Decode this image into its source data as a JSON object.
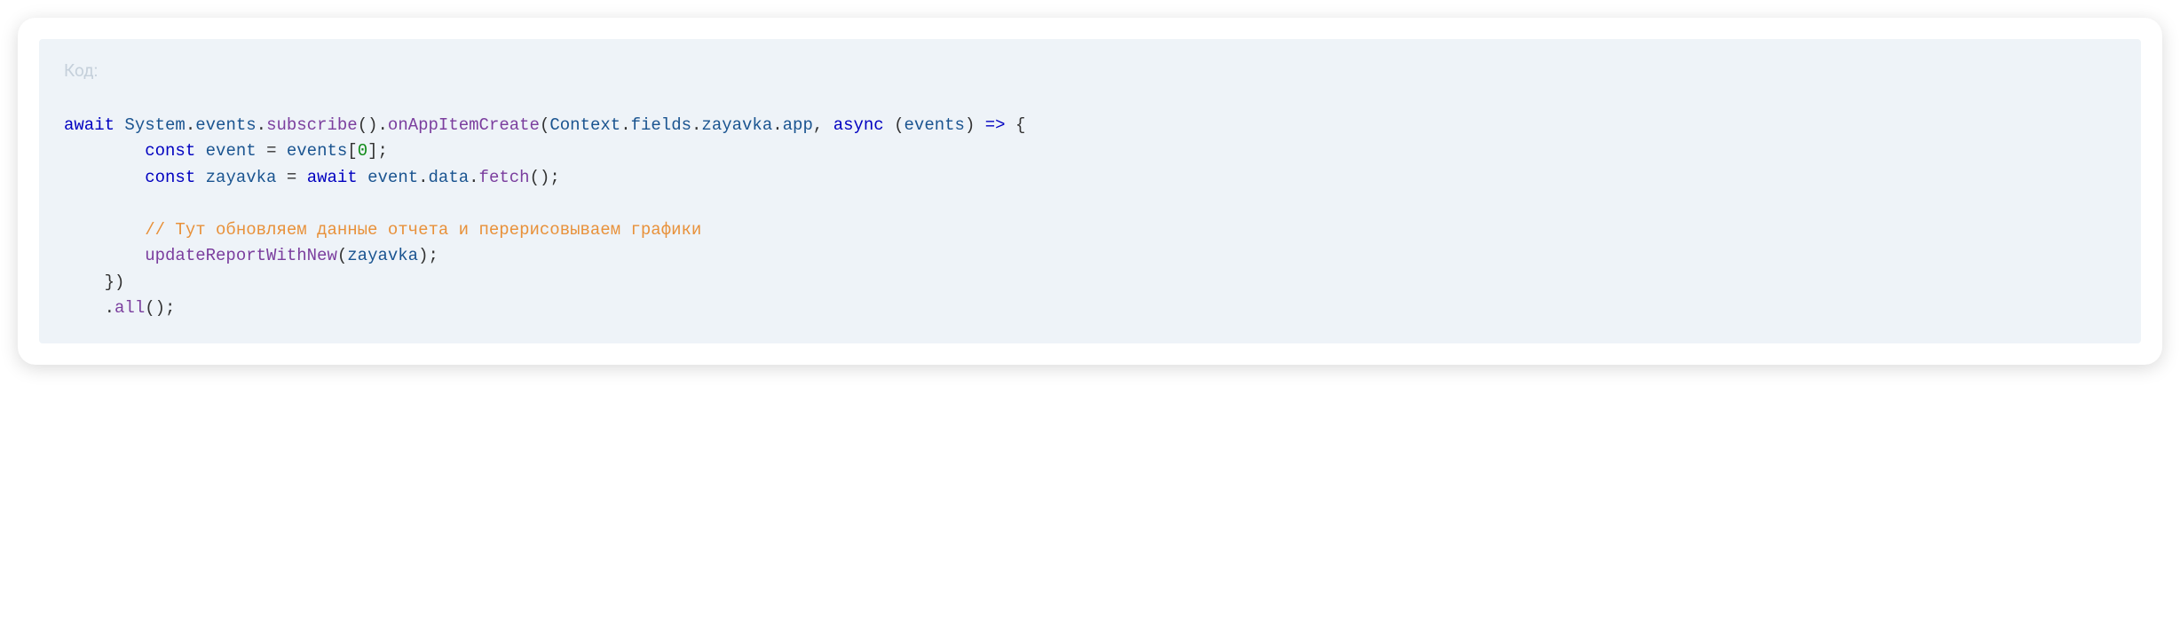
{
  "label": "Код:",
  "code": {
    "line1": {
      "indent": "",
      "kw1": "await",
      "sp1": " ",
      "cls1": "System",
      "dot1": ".",
      "prop1": "events",
      "dot2": ".",
      "meth1": "subscribe",
      "p1": "().",
      "meth2": "onAppItemCreate",
      "p2": "(",
      "cls2": "Context",
      "dot3": ".",
      "prop2": "fields",
      "dot4": ".",
      "prop3": "zayavka",
      "dot5": ".",
      "prop4": "app",
      "p3": ", ",
      "kw2": "async",
      "sp2": " ",
      "p4": "(",
      "var1": "events",
      "p5": ") ",
      "arrow": "=>",
      "sp3": " ",
      "brace": "{"
    },
    "line2": {
      "indent": "        ",
      "kw1": "const",
      "sp1": " ",
      "var1": "event",
      "sp2": " ",
      "op": "=",
      "sp3": " ",
      "var2": "events",
      "b1": "[",
      "num": "0",
      "b2": "];"
    },
    "line3": {
      "indent": "        ",
      "kw1": "const",
      "sp1": " ",
      "var1": "zayavka",
      "sp2": " ",
      "op": "=",
      "sp3": " ",
      "kw2": "await",
      "sp4": " ",
      "var2": "event",
      "dot1": ".",
      "prop1": "data",
      "dot2": ".",
      "meth1": "fetch",
      "p1": "();"
    },
    "line4": {
      "blank": ""
    },
    "line5": {
      "indent": "        ",
      "comment": "// Тут обновляем данные отчета и перерисовываем графики"
    },
    "line6": {
      "indent": "        ",
      "meth1": "updateReportWithNew",
      "p1": "(",
      "var1": "zayavka",
      "p2": ");"
    },
    "line7": {
      "indent": "    ",
      "brace": "})"
    },
    "line8": {
      "indent": "    ",
      "dot1": ".",
      "meth1": "all",
      "p1": "();"
    }
  }
}
